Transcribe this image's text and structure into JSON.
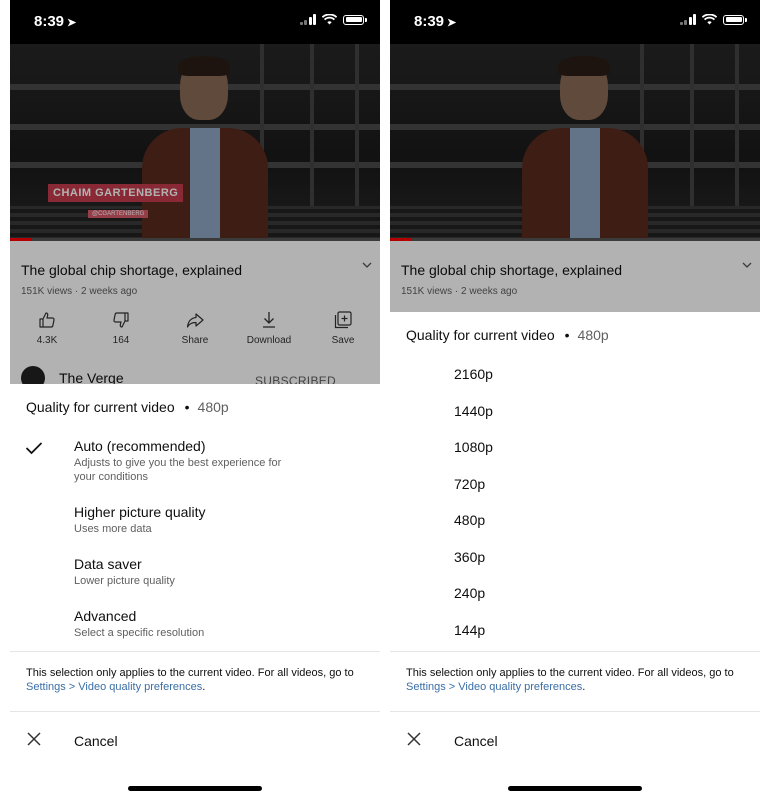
{
  "status_bar": {
    "time": "8:39"
  },
  "video": {
    "lower_third_name": "CHAIM GARTENBERG",
    "lower_third_handle": "@CGARTENBERG",
    "watched_fraction": 0.06
  },
  "video_info": {
    "title": "The global chip shortage, explained",
    "stats": "151K views · 2 weeks ago",
    "actions": [
      {
        "label": "4.3K",
        "icon": "thumbs-up-icon"
      },
      {
        "label": "164",
        "icon": "thumbs-down-icon"
      },
      {
        "label": "Share",
        "icon": "share-icon"
      },
      {
        "label": "Download",
        "icon": "download-icon"
      },
      {
        "label": "Save",
        "icon": "save-icon"
      }
    ],
    "channel_name": "The Verge",
    "subscribe_label": "SUBSCRIBED"
  },
  "left_sheet": {
    "title": "Quality for current video",
    "dot": "•",
    "selected": "480p",
    "options": [
      {
        "label": "Auto (recommended)",
        "desc": "Adjusts to give you the best experience for your conditions",
        "checked": true
      },
      {
        "label": "Higher picture quality",
        "desc": "Uses more data",
        "checked": false
      },
      {
        "label": "Data saver",
        "desc": "Lower picture quality",
        "checked": false
      },
      {
        "label": "Advanced",
        "desc": "Select a specific resolution",
        "checked": false
      }
    ],
    "note_prefix": "This selection only applies to the current video. For all videos, go to ",
    "note_link": "Settings > Video quality preferences",
    "note_suffix": ".",
    "cancel": "Cancel"
  },
  "right_sheet": {
    "title": "Quality for current video",
    "dot": "•",
    "selected": "480p",
    "resolutions": [
      "2160p",
      "1440p",
      "1080p",
      "720p",
      "480p",
      "360p",
      "240p",
      "144p"
    ],
    "note_prefix": "This selection only applies to the current video. For all videos, go to ",
    "note_link": "Settings > Video quality preferences",
    "note_suffix": ".",
    "cancel": "Cancel"
  },
  "colors": {
    "link": "#3a6ea5",
    "progress": "#ff0000",
    "lower_third": "#c33b4c"
  }
}
